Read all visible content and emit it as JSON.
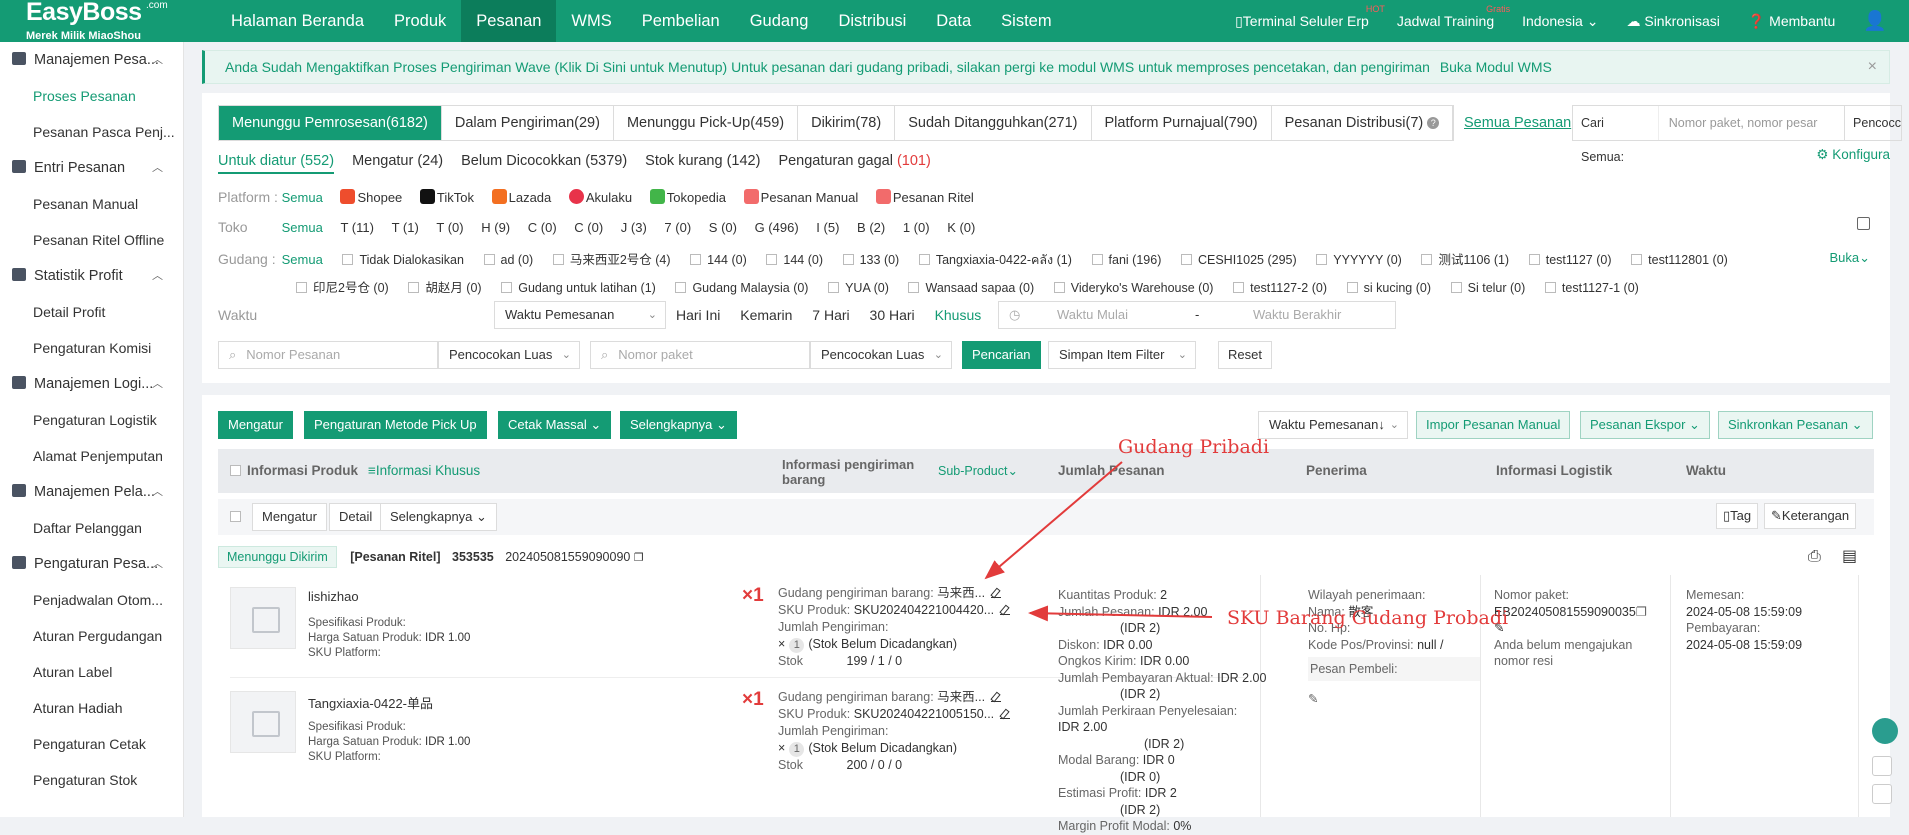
{
  "brand": {
    "name": "EasyBoss",
    "com": ".com",
    "tagline": "Merek Milik MiaoShou"
  },
  "topnav": [
    "Halaman Beranda",
    "Produk",
    "Pesanan",
    "WMS",
    "Pembelian",
    "Gudang",
    "Distribusi",
    "Data",
    "Sistem"
  ],
  "topnav_active": "Pesanan",
  "topright": {
    "terminal": "Terminal Seluler Erp",
    "terminal_badge": "HOT",
    "training": "Jadwal Training",
    "training_badge": "Gratis",
    "lang": "Indonesia",
    "sync": "Sinkronisasi",
    "help": "Membantu"
  },
  "sidebar": [
    {
      "group": "Manajemen Pesa...",
      "items": [
        "Proses Pesanan",
        "Pesanan Pasca Penj..."
      ]
    },
    {
      "group": "Entri Pesanan",
      "items": [
        "Pesanan Manual",
        "Pesanan Ritel Offline"
      ]
    },
    {
      "group": "Statistik Profit",
      "items": [
        "Detail Profit",
        "Pengaturan Komisi"
      ]
    },
    {
      "group": "Manajemen Logi...",
      "items": [
        "Pengaturan Logistik",
        "Alamat Penjemputan"
      ]
    },
    {
      "group": "Manajemen Pela...",
      "items": [
        "Daftar Pelanggan"
      ]
    },
    {
      "group": "Pengaturan Pesa...",
      "items": [
        "Penjadwalan Otom...",
        "Aturan Pergudangan",
        "Aturan Label",
        "Aturan Hadiah",
        "Pengaturan Cetak",
        "Pengaturan Stok"
      ]
    }
  ],
  "banner": {
    "text": "Anda Sudah Mengaktifkan Proses Pengiriman Wave (Klik Di Sini untuk Menutup) Untuk pesanan dari gudang pribadi, silakan pergi ke modul WMS untuk memproses pencetakan, dan pengiriman",
    "link": "Buka Modul WMS",
    "close": "×"
  },
  "tabs": [
    "Menunggu Pemrosesan(6182)",
    "Dalam Pengiriman(29)",
    "Menunggu Pick-Up(459)",
    "Dikirim(78)",
    "Sudah Ditangguhkan(271)",
    "Platform Purnajual(790)",
    "Pesanan Distribusi(7)"
  ],
  "all_orders": "Semua Pesanan",
  "search_all": {
    "label": "Cari Semua:",
    "placeholder": "Nomor paket, nomor pesar",
    "more": "Pencocc"
  },
  "subtabs": {
    "s1": "Untuk diatur (552)",
    "s2": "Mengatur (24)",
    "s3": "Belum Dicocokkan (5379)",
    "s4": "Stok kurang (142)",
    "s5_label": "Pengaturan gagal ",
    "s5_count": "(101)"
  },
  "konfig": "Konfigura",
  "platform": {
    "label": "Platform :",
    "all": "Semua",
    "items": [
      "Shopee",
      "TikTok",
      "Lazada",
      "Akulaku",
      "Tokopedia",
      "Pesanan Manual",
      "Pesanan Ritel"
    ]
  },
  "toko": {
    "label": "Toko",
    "all": "Semua",
    "items": [
      "T (11)",
      "T (1)",
      "T (0)",
      "H (9)",
      "C (0)",
      "C (0)",
      "J (3)",
      "7 (0)",
      "S (0)",
      "G (496)",
      "I (5)",
      "B (2)",
      "1 (0)",
      "K (0)"
    ]
  },
  "gudang": {
    "label": "Gudang :",
    "all": "Semua",
    "row1": [
      "Tidak Dialokasikan",
      "ad (0)",
      "马来西亚2号仓 (4)",
      "144 (0)",
      "144 (0)",
      "133 (0)",
      "Tangxiaxia-0422-คลัง (1)",
      "fani (196)",
      "CESHI1025 (295)",
      "YYYYYY (0)",
      "测试1106 (1)",
      "test1127 (0)",
      "test112801 (0)"
    ],
    "row2": [
      "印尼2号仓 (0)",
      "胡赵月 (0)",
      "Gudang untuk latihan (1)",
      "Gudang Malaysia (0)",
      "YUA (0)",
      "Wansaad sapaa (0)",
      "Videryko's Warehouse (0)",
      "test1127-2 (0)",
      "si kucing (0)",
      "Si telur (0)",
      "test1127-1 (0)"
    ],
    "expand": "Buka"
  },
  "waktu": {
    "label": "Waktu",
    "select": "Waktu Pemesanan",
    "quick": [
      "Hari Ini",
      "Kemarin",
      "7 Hari",
      "30 Hari",
      "Khusus"
    ],
    "start": "Waktu Mulai",
    "sep": "-",
    "end": "Waktu Berakhir"
  },
  "search": {
    "order_ph": "Nomor Pesanan",
    "match1": "Pencocokan Luas",
    "pkg_ph": "Nomor paket",
    "match2": "Pencocokan Luas",
    "search_btn": "Pencarian",
    "save_filter": "Simpan Item Filter",
    "reset": "Reset"
  },
  "actions": {
    "mengatur": "Mengatur",
    "pickup": "Pengaturan Metode Pick Up",
    "cetak": "Cetak Massal",
    "lainnya": "Selengkapnya",
    "sort": "Waktu Pemesanan↓",
    "impor": "Impor Pesanan Manual",
    "ekspor": "Pesanan Ekspor",
    "sinkron": "Sinkronkan Pesanan"
  },
  "table_head": {
    "produk": "Informasi Produk",
    "khusus": "≡Informasi Khusus",
    "kirim": "Informasi pengiriman barang",
    "subproduct": "Sub-Product",
    "jumlah": "Jumlah Pesanan",
    "penerima": "Penerima",
    "logistik": "Informasi Logistik",
    "waktu": "Waktu"
  },
  "bar2": {
    "mengatur": "Mengatur",
    "detail": "Detail",
    "lainnya": "Selengkapnya",
    "tag": "Tag",
    "keterangan": "Keterangan"
  },
  "order": {
    "status": "Menunggu Dikirim",
    "type": "[Pesanan Ritel]",
    "id": "353535",
    "number": "202405081559090090"
  },
  "products": [
    {
      "name": "lishizhao",
      "spec": "Spesifikasi Produk:",
      "price_label": "Harga Satuan Produk:",
      "price": "IDR 1.00",
      "sku_label": "SKU Platform:",
      "qty": "×1",
      "wh_label": "Gudang pengiriman barang:",
      "wh": "马来西...",
      "sku_prod_label": "SKU Produk:",
      "sku_prod": "SKU202404221004420...",
      "ship_qty_label": "Jumlah Pengiriman:",
      "ship_x": "×",
      "ship_n": "1",
      "ship_note": "(Stok Belum Dicadangkan)",
      "stock_label": "Stok",
      "stock": "199 / 1 / 0"
    },
    {
      "name": "Tangxiaxia-0422-单品",
      "spec": "Spesifikasi Produk:",
      "price_label": "Harga Satuan Produk:",
      "price": "IDR 1.00",
      "sku_label": "SKU Platform:",
      "qty": "×1",
      "wh_label": "Gudang pengiriman barang:",
      "wh": "马来西...",
      "sku_prod_label": "SKU Produk:",
      "sku_prod": "SKU202404221005150...",
      "ship_qty_label": "Jumlah Pengiriman:",
      "ship_x": "×",
      "ship_n": "1",
      "ship_note": "(Stok Belum Dicadangkan)",
      "stock_label": "Stok",
      "stock": "200 / 0 / 0"
    }
  ],
  "amount": {
    "l1": "Kuantitas Produk:",
    "v1": "2",
    "l2": "Jumlah Pesanan:",
    "v2": "IDR 2.00",
    "v2b": "(IDR 2)",
    "l3": "Diskon:",
    "v3": "IDR 0.00",
    "l4": "Ongkos Kirim:",
    "v4": "IDR 0.00",
    "l5": "Jumlah Pembayaran Aktual:",
    "v5": "IDR 2.00",
    "v5b": "(IDR 2)",
    "l6": "Jumlah Perkiraan Penyelesaian:",
    "v6": "IDR 2.00",
    "v6b": "(IDR 2)",
    "l7": "Modal Barang:",
    "v7": "IDR 0",
    "v7b": "(IDR 0)",
    "l8": "Estimasi Profit:",
    "v8": "IDR 2",
    "v8b": "(IDR 2)",
    "l9": "Margin Profit Modal:",
    "v9": "0%"
  },
  "receiver": {
    "l1": "Wilayah penerimaan:",
    "l2": "Nama:",
    "v2": "散客",
    "l3": "No. Hp:",
    "l4": "Kode Pos/Provinsi:",
    "v4": "null /",
    "buyer": "Pesan Pembeli:"
  },
  "logistic": {
    "l1": "Nomor paket:",
    "v1": "EB202405081559090035",
    "note1": "Anda belum mengajukan",
    "note2": "nomor resi"
  },
  "time": {
    "l1": "Memesan:",
    "v1": "2024-05-08 15:59:09",
    "l2": "Pembayaran:",
    "v2": "2024-05-08 15:59:09"
  },
  "annotations": {
    "a1": "Gudang Pribadi",
    "a2": "SKU Barang Gudang Probadi"
  },
  "colors": {
    "brand": "#149b74",
    "alert": "#e23b3b",
    "shopee": "#ee4d2d",
    "tiktok": "#111111",
    "lazada": "#f36f21",
    "akulaku": "#e8334a",
    "tokopedia": "#42b549",
    "manual": "#f26b6b"
  }
}
